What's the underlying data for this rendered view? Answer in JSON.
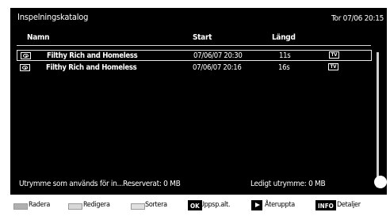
{
  "header": {
    "title": "Inspelningskatalog",
    "clock": "Tor 07/06 20:15"
  },
  "columns": {
    "name": "Namn",
    "start": "Start",
    "length": "Längd"
  },
  "recordings": [
    {
      "name": "Filthy Rich and Homeless",
      "start": "07/06/07  20:30",
      "length": "11s",
      "badge": "TV",
      "icon": "eye-icon",
      "selected": true
    },
    {
      "name": "Filthy Rich and Homeless",
      "start": "07/06/07  20:16",
      "length": "16s",
      "badge": "TV",
      "icon": "eye-icon",
      "selected": false
    }
  ],
  "status": {
    "used": "Utrymme som används för in...",
    "reserved": "Reserverat: 0 MB",
    "free": "Ledigt utrymme: 0 MB"
  },
  "buttons": {
    "red": "Radera",
    "green": "Redigera",
    "yellow": "Sortera",
    "ok_key": "OK",
    "ok": "Uppsp.alt.",
    "play": "Återuppta",
    "info_key": "INFO",
    "info": "Detaljer"
  },
  "colors": {
    "background": "#000000",
    "text": "#ffffff",
    "red_button": "#b0b0b0",
    "green_button": "#d8d8d8",
    "yellow_button": "#e0e0e0"
  }
}
